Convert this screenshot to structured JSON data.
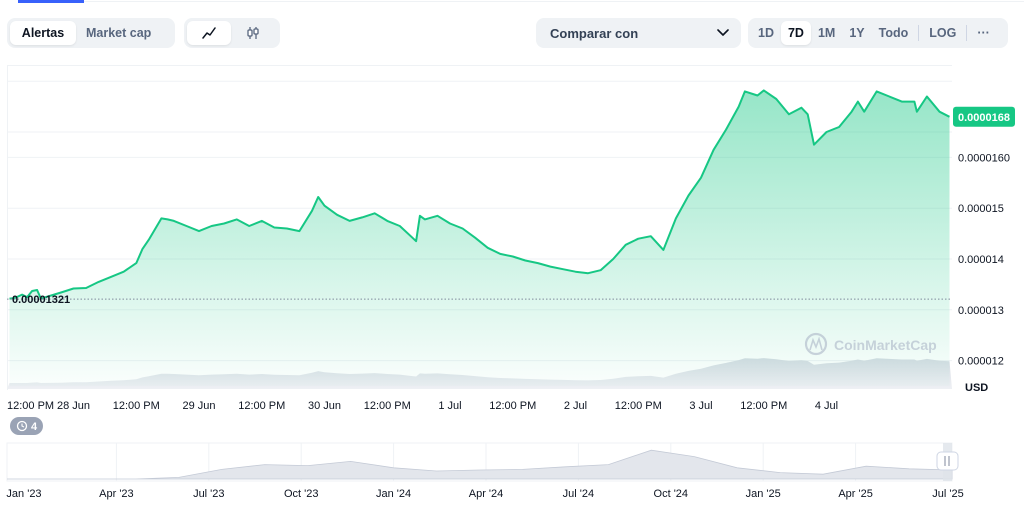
{
  "tabs": [
    {
      "label": "Alertas",
      "active": true
    },
    {
      "label": "Market cap",
      "active": false
    }
  ],
  "chart_types": [
    {
      "icon": "line-chart-icon",
      "active": true
    },
    {
      "icon": "candlestick-icon",
      "active": false
    }
  ],
  "compare": {
    "label": "Comparar con"
  },
  "ranges": [
    "1D",
    "7D",
    "1M",
    "1Y",
    "Todo"
  ],
  "active_range": "7D",
  "log_label": "LOG",
  "more_label": "···",
  "colors": {
    "line": "#16c784",
    "accent": "#3861fb",
    "badge_text": "#ffffff"
  },
  "currency_label": "USD",
  "watermark": "CoinMarketCap",
  "start_price_label": "0.00001321",
  "current_price_label": "0.0000168",
  "alerts_count": "4",
  "chart_data": {
    "type": "area",
    "title": "",
    "xlabel": "",
    "ylabel": "",
    "ylim": [
      1.15e-05,
      1.78e-05
    ],
    "y_ticks": [
      "0.0000160",
      "0.000015",
      "0.000014",
      "0.000013",
      "0.000012"
    ],
    "y_tick_values": [
      1.6e-05,
      1.5e-05,
      1.4e-05,
      1.3e-05,
      1.2e-05
    ],
    "x_ticks": [
      "12:00 PM",
      "28 Jun",
      "12:00 PM",
      "29 Jun",
      "12:00 PM",
      "30 Jun",
      "12:00 PM",
      "1 Jul",
      "12:00 PM",
      "2 Jul",
      "12:00 PM",
      "3 Jul",
      "12:00 PM",
      "4 Jul"
    ],
    "x_tick_values": [
      -0.5,
      0,
      0.5,
      1,
      1.5,
      2,
      2.5,
      3,
      3.5,
      4,
      4.5,
      5,
      5.5,
      6
    ],
    "x_unit": "days since 28 Jun",
    "start_value": 1.321e-05,
    "current_value": 1.68e-05,
    "series": [
      {
        "points": [
          [
            -0.51,
            1.322e-05
          ],
          [
            -0.47,
            1.323e-05
          ],
          [
            -0.41,
            1.33e-05
          ],
          [
            -0.37,
            1.325e-05
          ],
          [
            -0.33,
            1.337e-05
          ],
          [
            -0.29,
            1.339e-05
          ],
          [
            -0.26,
            1.322e-05
          ],
          [
            -0.1,
            1.334e-05
          ],
          [
            0.0,
            1.342e-05
          ],
          [
            0.1,
            1.343e-05
          ],
          [
            0.2,
            1.355e-05
          ],
          [
            0.3,
            1.365e-05
          ],
          [
            0.4,
            1.375e-05
          ],
          [
            0.5,
            1.392e-05
          ],
          [
            0.55,
            1.42e-05
          ],
          [
            0.6,
            1.438e-05
          ],
          [
            0.7,
            1.48e-05
          ],
          [
            0.75,
            1.478e-05
          ],
          [
            0.8,
            1.475e-05
          ],
          [
            0.9,
            1.465e-05
          ],
          [
            1.0,
            1.455e-05
          ],
          [
            1.1,
            1.465e-05
          ],
          [
            1.2,
            1.47e-05
          ],
          [
            1.3,
            1.478e-05
          ],
          [
            1.4,
            1.465e-05
          ],
          [
            1.5,
            1.475e-05
          ],
          [
            1.6,
            1.462e-05
          ],
          [
            1.7,
            1.46e-05
          ],
          [
            1.8,
            1.455e-05
          ],
          [
            1.9,
            1.495e-05
          ],
          [
            1.95,
            1.522e-05
          ],
          [
            2.0,
            1.505e-05
          ],
          [
            2.1,
            1.487e-05
          ],
          [
            2.2,
            1.475e-05
          ],
          [
            2.3,
            1.482e-05
          ],
          [
            2.4,
            1.49e-05
          ],
          [
            2.5,
            1.475e-05
          ],
          [
            2.6,
            1.465e-05
          ],
          [
            2.7,
            1.442e-05
          ],
          [
            2.73,
            1.435e-05
          ],
          [
            2.76,
            1.485e-05
          ],
          [
            2.8,
            1.478e-05
          ],
          [
            2.9,
            1.485e-05
          ],
          [
            3.0,
            1.47e-05
          ],
          [
            3.1,
            1.46e-05
          ],
          [
            3.2,
            1.442e-05
          ],
          [
            3.3,
            1.422e-05
          ],
          [
            3.4,
            1.41e-05
          ],
          [
            3.5,
            1.405e-05
          ],
          [
            3.6,
            1.397e-05
          ],
          [
            3.7,
            1.392e-05
          ],
          [
            3.8,
            1.385e-05
          ],
          [
            3.9,
            1.38e-05
          ],
          [
            4.0,
            1.375e-05
          ],
          [
            4.1,
            1.372e-05
          ],
          [
            4.2,
            1.378e-05
          ],
          [
            4.3,
            1.4e-05
          ],
          [
            4.4,
            1.428e-05
          ],
          [
            4.5,
            1.44e-05
          ],
          [
            4.6,
            1.445e-05
          ],
          [
            4.7,
            1.418e-05
          ],
          [
            4.8,
            1.48e-05
          ],
          [
            4.9,
            1.525e-05
          ],
          [
            5.0,
            1.56e-05
          ],
          [
            5.1,
            1.615e-05
          ],
          [
            5.2,
            1.655e-05
          ],
          [
            5.3,
            1.7e-05
          ],
          [
            5.35,
            1.73e-05
          ],
          [
            5.45,
            1.722e-05
          ],
          [
            5.5,
            1.732e-05
          ],
          [
            5.6,
            1.715e-05
          ],
          [
            5.7,
            1.685e-05
          ],
          [
            5.8,
            1.698e-05
          ],
          [
            5.85,
            1.685e-05
          ],
          [
            5.9,
            1.625e-05
          ],
          [
            6.0,
            1.65e-05
          ],
          [
            6.1,
            1.66e-05
          ],
          [
            6.2,
            1.69e-05
          ],
          [
            6.25,
            1.71e-05
          ],
          [
            6.3,
            1.69e-05
          ],
          [
            6.4,
            1.73e-05
          ],
          [
            6.5,
            1.72e-05
          ],
          [
            6.6,
            1.71e-05
          ],
          [
            6.7,
            1.71e-05
          ],
          [
            6.72,
            1.69e-05
          ],
          [
            6.8,
            1.72e-05
          ],
          [
            6.9,
            1.69e-05
          ],
          [
            6.98,
            1.68e-05
          ]
        ]
      }
    ]
  },
  "range_slider": {
    "labels": [
      "Jan '23",
      "Apr '23",
      "Jul '23",
      "Oct '23",
      "Jan '24",
      "Apr '24",
      "Jul '24",
      "Oct '24",
      "Jan '25",
      "Apr '25",
      "Jul '25"
    ],
    "history": [
      [
        "Jan '23",
        0.0
      ],
      [
        "Apr '23",
        0.0
      ],
      [
        "Jul '23",
        0.0
      ],
      [
        "Oct '23",
        0.0
      ],
      [
        "Jan '24",
        0.05
      ],
      [
        "Feb '24",
        0.3
      ],
      [
        "Mar '24",
        0.45
      ],
      [
        "Apr '24",
        0.42
      ],
      [
        "May '24",
        0.55
      ],
      [
        "Jun '24",
        0.35
      ],
      [
        "Jul '24",
        0.25
      ],
      [
        "Aug '24",
        0.28
      ],
      [
        "Sep '24",
        0.3
      ],
      [
        "Oct '24",
        0.38
      ],
      [
        "Nov '24",
        0.45
      ],
      [
        "Dec '24",
        0.9
      ],
      [
        "Jan '25",
        0.7
      ],
      [
        "Feb '25",
        0.35
      ],
      [
        "Mar '25",
        0.2
      ],
      [
        "Apr '25",
        0.15
      ],
      [
        "May '25",
        0.4
      ],
      [
        "Jun '25",
        0.32
      ],
      [
        "Jul '25",
        0.28
      ]
    ]
  }
}
